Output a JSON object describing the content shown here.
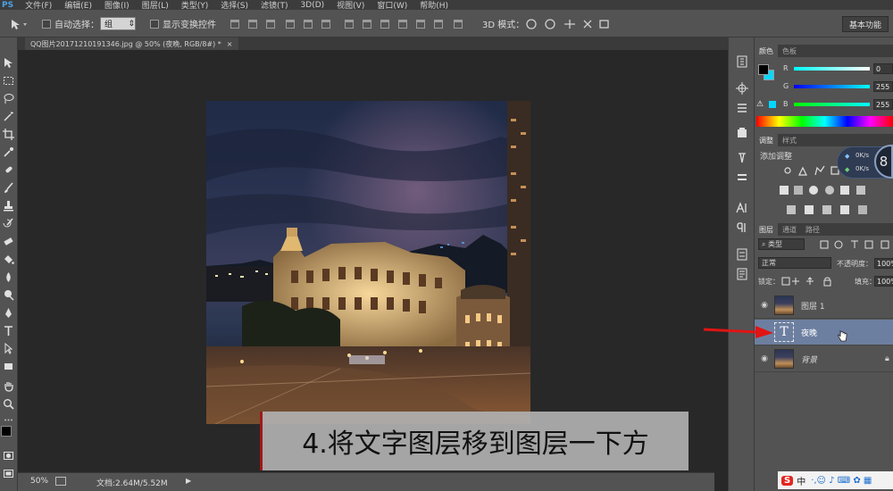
{
  "menubar": {
    "app": "PS",
    "items": [
      "文件(F)",
      "编辑(E)",
      "图像(I)",
      "图层(L)",
      "类型(Y)",
      "选择(S)",
      "滤镜(T)",
      "3D(D)",
      "视图(V)",
      "窗口(W)",
      "帮助(H)"
    ]
  },
  "options": {
    "auto_select_label": "自动选择：",
    "auto_select_value": "组",
    "show_transform_label": "显示变换控件",
    "mode_3d_label": "3D 模式：",
    "workspace_label": "基本功能"
  },
  "document": {
    "tab_title": "QQ图片20171210191346.jpg @ 50% (夜晚, RGB/8#) *",
    "close_glyph": "×"
  },
  "status": {
    "zoom": "50%",
    "doc_info": "文档:2.64M/5.52M"
  },
  "color_panel": {
    "tabs": [
      "颜色",
      "色板"
    ],
    "channels": [
      {
        "label": "R",
        "value": "0"
      },
      {
        "label": "G",
        "value": "255"
      },
      {
        "label": "B",
        "value": "255"
      }
    ],
    "foreground": "#000000",
    "background": "#00d8ff"
  },
  "adjust_panel": {
    "tabs": [
      "调整",
      "样式"
    ],
    "add_label": "添加调整",
    "net_speed": [
      "0K/s",
      "0K/s"
    ],
    "badge": "8"
  },
  "layers_panel": {
    "tabs": [
      "图层",
      "通道",
      "路径"
    ],
    "filter_label": "类型",
    "blend_mode": "正常",
    "opacity_label": "不透明度：",
    "opacity_value": "100%",
    "lock_label": "锁定：",
    "fill_label": "填充：",
    "fill_value": "100%",
    "layers": [
      {
        "name": "图层 1",
        "type": "image",
        "selected": false
      },
      {
        "name": "夜晚",
        "type": "text",
        "selected": true
      },
      {
        "name": "背景",
        "type": "image",
        "selected": false
      }
    ]
  },
  "caption": "4.将文字图层移到图层一下方",
  "taskbar_ime": "S 中"
}
